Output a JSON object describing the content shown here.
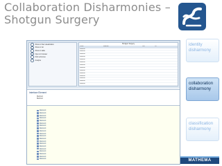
{
  "slide": {
    "title_line1": "Collaboration Disharmonies –",
    "title_line2": "Shotgun Surgery"
  },
  "sidebar": {
    "identity": [
      "identity",
      "disharmony"
    ],
    "collaboration": [
      "collaboration",
      "disharmony"
    ],
    "classification": [
      "classification",
      "disharmony"
    ]
  },
  "brand": {
    "label": "MATHEMA"
  },
  "colors": {
    "title_gray": "#8c8c8c",
    "logo_blue": "#24568f",
    "active_box": "#a8c8ea",
    "inactive_text": "#8ab4e2",
    "brand_blue": "#1f497d"
  },
  "ide": {
    "radio_options": [
      "Show in flow visualization",
      "Show in list",
      "Show in table",
      "Open in browser",
      "Find extremes",
      "Analyze"
    ],
    "table": {
      "caption": "Shotgun Surgery",
      "columns": [
        "Class",
        "Method",
        "CM",
        "CC"
      ],
      "rows": [
        [
          "Element",
          "",
          "",
          ""
        ],
        [
          "Element",
          "",
          "",
          ""
        ],
        [
          "Element",
          "",
          "",
          ""
        ],
        [
          "Element",
          "",
          "",
          ""
        ],
        [
          "Element",
          "",
          "",
          ""
        ],
        [
          "Element",
          "",
          "",
          ""
        ],
        [
          "Element",
          "",
          "",
          ""
        ],
        [
          "Element",
          "",
          "",
          ""
        ],
        [
          "Element",
          "",
          "",
          ""
        ],
        [
          "Element",
          "",
          "",
          ""
        ],
        [
          "Element",
          "",
          "",
          ""
        ],
        [
          "Element",
          "",
          "",
          ""
        ],
        [
          "Element",
          "",
          "",
          ""
        ],
        [
          "Element",
          "",
          "",
          ""
        ],
        [
          "Element",
          "",
          "",
          ""
        ],
        [
          "Element",
          "",
          "",
          ""
        ],
        [
          "Element",
          "",
          "",
          ""
        ],
        [
          "Element",
          "",
          "",
          ""
        ],
        [
          "Element",
          "",
          "",
          ""
        ]
      ]
    },
    "editor": {
      "line": "Interface Element",
      "sub": [
        "Method",
        "Method"
      ]
    },
    "tree": {
      "headers": [
        "",
        ""
      ],
      "items": [
        "Element",
        "Element",
        "Element",
        "Element",
        "Element",
        "Element",
        "Element",
        "Element",
        "Element",
        "Element",
        "Element",
        "Element",
        "Element",
        "Element",
        "Element",
        "Element",
        "Element",
        "Element",
        "Element",
        "Element"
      ]
    }
  }
}
